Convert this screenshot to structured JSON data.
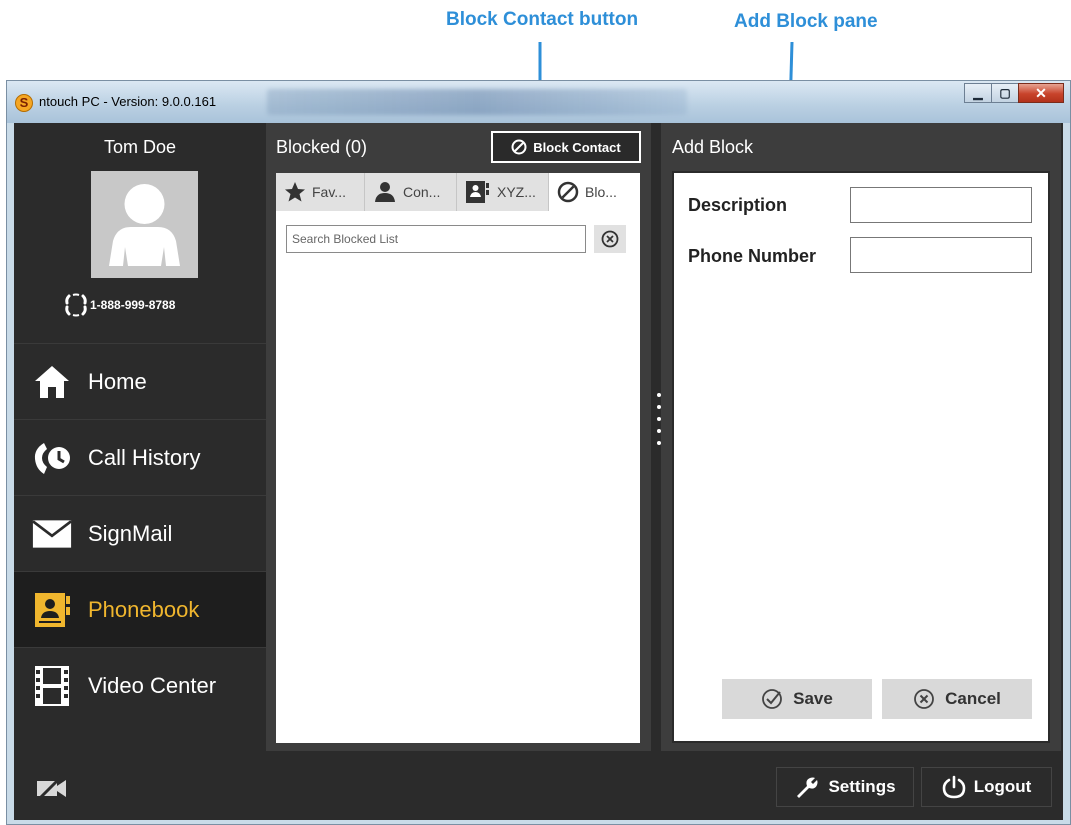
{
  "callouts": {
    "block_contact": "Block Contact button",
    "add_block": "Add Block pane"
  },
  "window": {
    "title": "ntouch PC  -  Version: 9.0.0.161",
    "logo_letter": "S"
  },
  "sidebar": {
    "user_name": "Tom Doe",
    "phone_number": "1-888-999-8788",
    "items": [
      {
        "label": "Home",
        "icon": "home-icon",
        "active": false
      },
      {
        "label": "Call History",
        "icon": "call-history-icon",
        "active": false
      },
      {
        "label": "SignMail",
        "icon": "envelope-icon",
        "active": false
      },
      {
        "label": "Phonebook",
        "icon": "phonebook-icon",
        "active": true
      },
      {
        "label": "Video Center",
        "icon": "film-icon",
        "active": false
      }
    ]
  },
  "blocked_panel": {
    "title": "Blocked (0)",
    "block_button_label": "Block Contact",
    "tabs": [
      {
        "label": "Fav...",
        "icon": "star-icon"
      },
      {
        "label": "Con...",
        "icon": "person-icon"
      },
      {
        "label": "XYZ...",
        "icon": "phonebook-icon"
      },
      {
        "label": "Blo...",
        "icon": "block-icon",
        "active": true
      }
    ],
    "search_placeholder": "Search Blocked List",
    "search_value": ""
  },
  "add_block_panel": {
    "title": "Add Block",
    "description_label": "Description",
    "description_value": "",
    "phone_label": "Phone Number",
    "phone_value": "",
    "save_label": "Save",
    "cancel_label": "Cancel"
  },
  "bottom_bar": {
    "settings_label": "Settings",
    "logout_label": "Logout"
  },
  "colors": {
    "accent": "#f0b62e",
    "callout": "#2e8fd8",
    "panel_bg": "#3d3d3d",
    "sidebar_bg": "#2b2b2b"
  }
}
